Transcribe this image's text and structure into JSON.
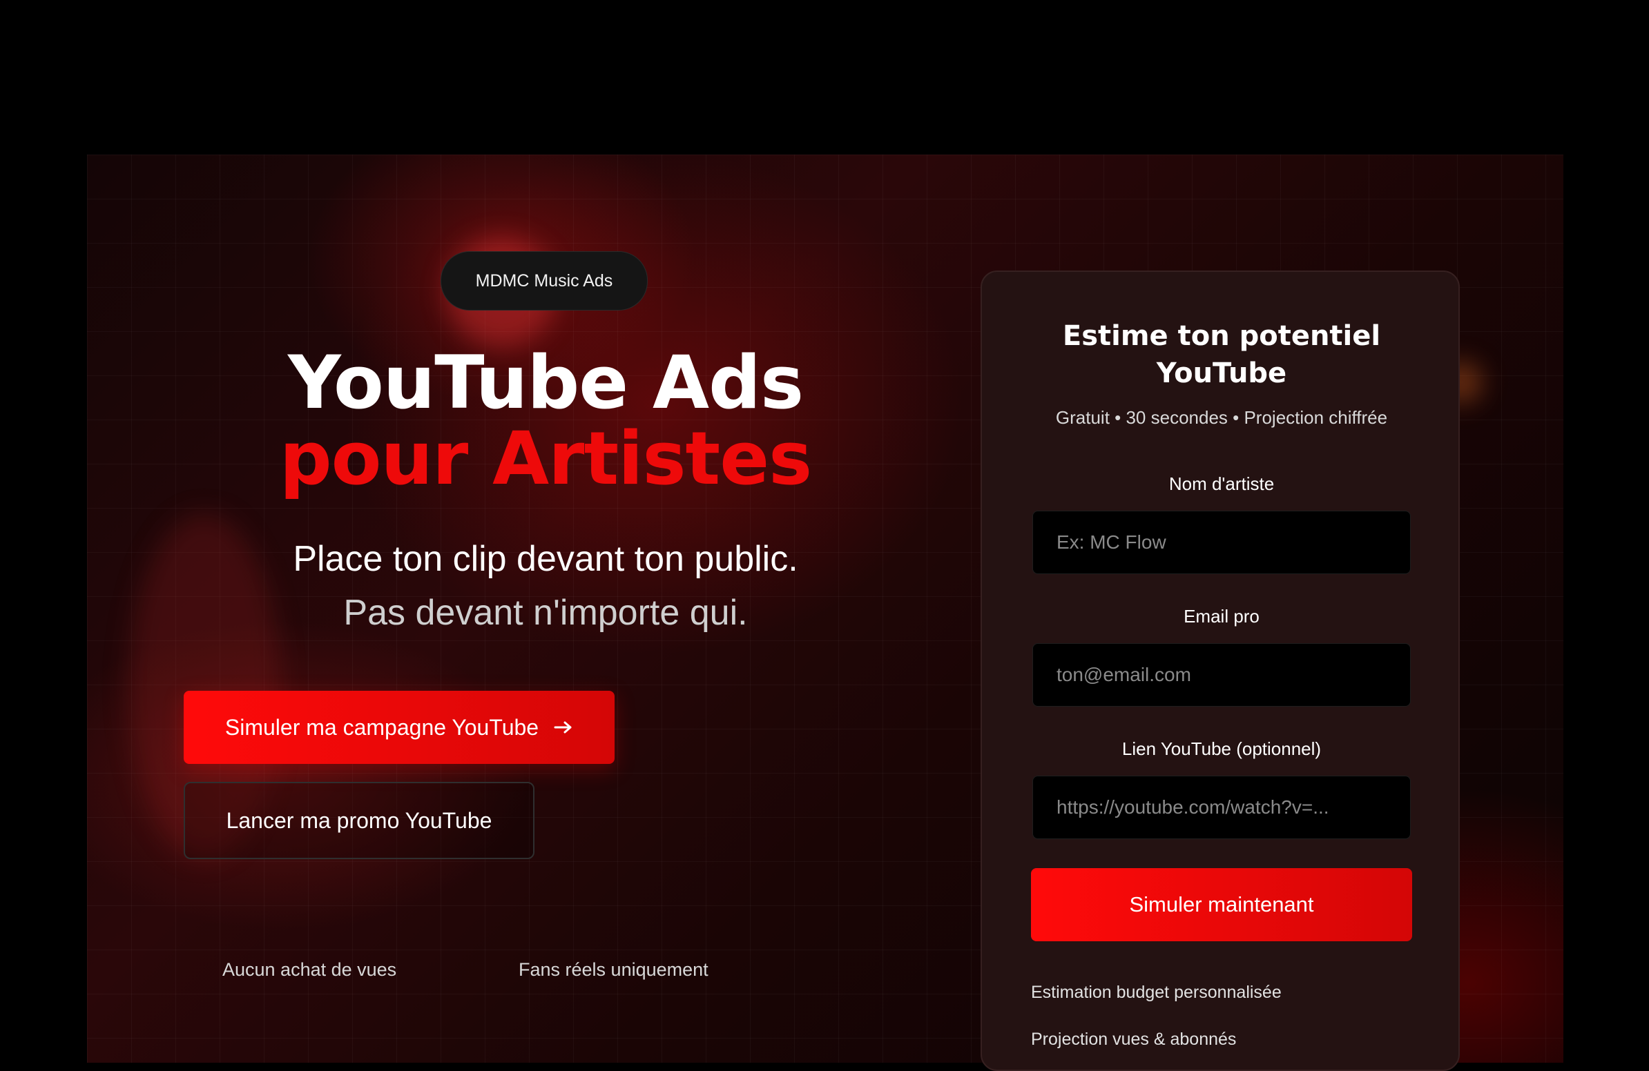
{
  "hero": {
    "badge": "MDMC Music Ads",
    "title_line1": "YouTube Ads",
    "title_line2": "pour Artistes",
    "subtitle_line1": "Place ton clip devant ton public.",
    "subtitle_line2": "Pas devant n'importe qui.",
    "primary_cta": "Simuler ma campagne YouTube",
    "primary_cta_icon": "arrow-right-icon",
    "secondary_cta": "Lancer ma promo YouTube",
    "trust_items": [
      "Aucun achat de vues",
      "Fans réels uniquement"
    ]
  },
  "form": {
    "title_line1": "Estime ton potentiel",
    "title_line2": "YouTube",
    "subtitle": "Gratuit • 30 secondes • Projection chiffrée",
    "fields": [
      {
        "label": "Nom d'artiste",
        "placeholder": "Ex: MC Flow"
      },
      {
        "label": "Email pro",
        "placeholder": "ton@email.com"
      },
      {
        "label": "Lien YouTube (optionnel)",
        "placeholder": "https://youtube.com/watch?v=..."
      }
    ],
    "submit_label": "Simuler maintenant",
    "features": [
      "Estimation budget personnalisée",
      "Projection vues & abonnés"
    ]
  },
  "colors": {
    "accent": "#ee0a0a",
    "background": "#000000",
    "card": "#241212"
  }
}
